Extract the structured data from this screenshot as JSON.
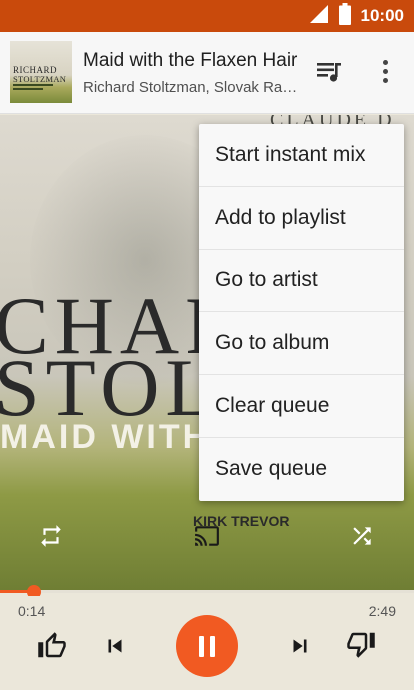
{
  "status_bar": {
    "time": "10:00",
    "icons": [
      "signal-icon",
      "battery-icon"
    ]
  },
  "now_playing": {
    "title": "Maid with the Flaxen Hair",
    "artist": "Richard Stoltzman, Slovak Radi...",
    "thumbnail_text": [
      "RICHARD",
      "STOLTZMAN"
    ],
    "icons": [
      "queue-music-icon",
      "more-vert-icon"
    ]
  },
  "album_art": {
    "top_text": "CLAUDE D",
    "big_lines": [
      "CHAR",
      "STOLT"
    ],
    "subtitle": "MAID WITH",
    "small_line": "KIRK TREVOR"
  },
  "overflow_menu": {
    "items": [
      "Start instant mix",
      "Add to playlist",
      "Go to artist",
      "Go to album",
      "Clear queue",
      "Save queue"
    ]
  },
  "controls": {
    "icons": [
      "repeat-icon",
      "cast-icon",
      "shuffle-icon",
      "thumbs-up-icon",
      "skip-previous-icon",
      "pause-icon",
      "skip-next-icon",
      "thumbs-down-icon"
    ]
  },
  "playback": {
    "elapsed": "0:14",
    "duration": "2:49",
    "progress_fraction": 0.083
  },
  "colors": {
    "accent": "#f15a22",
    "status_bar": "#c94a0c",
    "header_bg": "#f7f7f7",
    "menu_bg": "#f8f8f8",
    "bottom_bg": "#ebe7da"
  }
}
